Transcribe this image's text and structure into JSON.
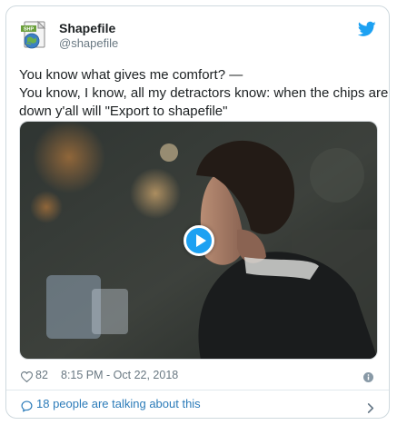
{
  "tweet": {
    "author": {
      "display_name": "Shapefile",
      "handle": "@shapefile",
      "avatar_icon": "shapefile-file-icon"
    },
    "brand_color": "#1da1f2",
    "text_lines": [
      "You know what gives me comfort? —",
      "You know, I know, all my detractors know: when the chips are",
      "down y'all will \"Export to shapefile\""
    ],
    "media": {
      "type": "video",
      "play_icon": "play-icon"
    },
    "likes": "82",
    "timestamp": "8:15 PM - Oct 22, 2018",
    "footer": {
      "conversation_text": "18 people are talking about this"
    }
  }
}
